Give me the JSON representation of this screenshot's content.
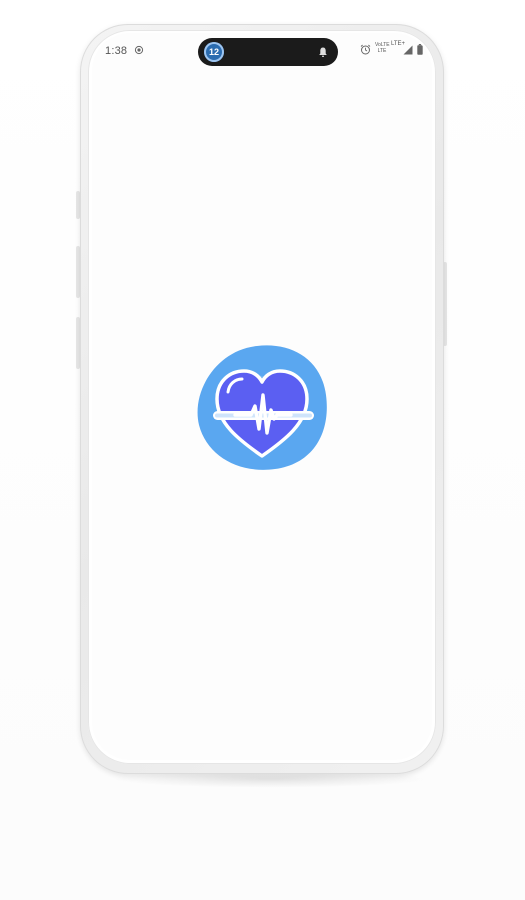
{
  "status_bar": {
    "time": "1:38",
    "notification_badge": "12",
    "network_label_top": "VoLTE",
    "network_label_bottom": "LTE",
    "data_label": "LTE+",
    "icons": [
      "sync-icon",
      "bell-icon",
      "alarm-icon",
      "signal-icon",
      "battery-icon"
    ]
  },
  "app": {
    "screen": "splash",
    "logo_icon": "heart-pulse-icon",
    "colors": {
      "logo_blob": "#5aa7f0",
      "heart": "#5b5ff2",
      "outline": "#ffffff",
      "screen_background": "#fdfdfd",
      "device_frame": "#ececec"
    }
  }
}
